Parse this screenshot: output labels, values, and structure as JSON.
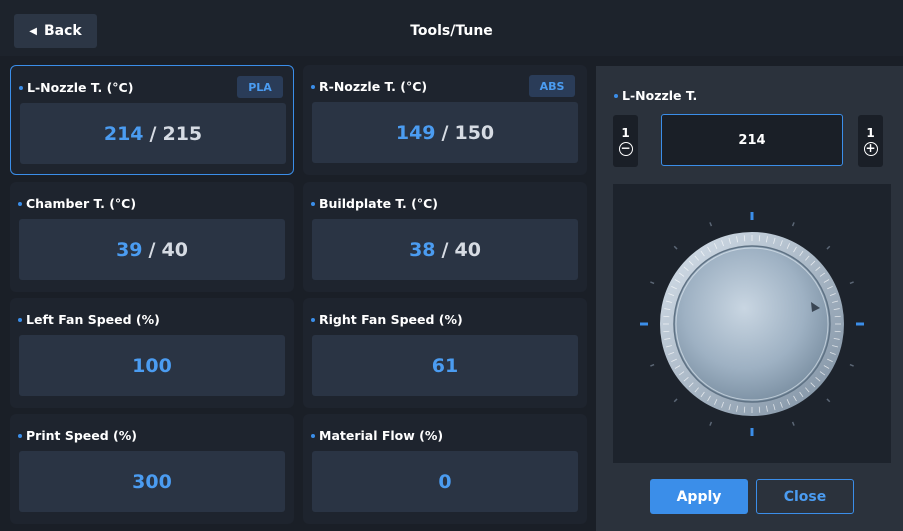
{
  "header": {
    "back_label": "Back",
    "title": "Tools/Tune"
  },
  "cards": {
    "l_nozzle": {
      "label": "L-Nozzle T. (°C)",
      "badge": "PLA",
      "current": "214",
      "separator": "/",
      "target": "215"
    },
    "r_nozzle": {
      "label": "R-Nozzle T. (°C)",
      "badge": "ABS",
      "current": "149",
      "separator": "/",
      "target": "150"
    },
    "chamber": {
      "label": "Chamber T. (°C)",
      "current": "39",
      "separator": "/",
      "target": "40"
    },
    "buildplate": {
      "label": "Buildplate T. (°C)",
      "current": "38",
      "separator": "/",
      "target": "40"
    },
    "left_fan": {
      "label": "Left Fan Speed (%)",
      "value": "100"
    },
    "right_fan": {
      "label": "Right Fan Speed (%)",
      "value": "61"
    },
    "print_speed": {
      "label": "Print Speed (%)",
      "value": "300"
    },
    "material_flow": {
      "label": "Material Flow (%)",
      "value": "0"
    }
  },
  "panel": {
    "label": "L-Nozzle T.",
    "decrement_step": "1",
    "increment_step": "1",
    "value": "214",
    "apply_label": "Apply",
    "close_label": "Close"
  },
  "colors": {
    "accent": "#3b8ee9",
    "background": "#1a1f27",
    "card": "#1e242e",
    "value_box": "#2a3444",
    "panel": "#2b323c"
  },
  "icons": {
    "back": "back-triangle-icon",
    "decrement": "minus-circle-icon",
    "increment": "plus-circle-icon",
    "dial": "rotary-dial-icon"
  }
}
